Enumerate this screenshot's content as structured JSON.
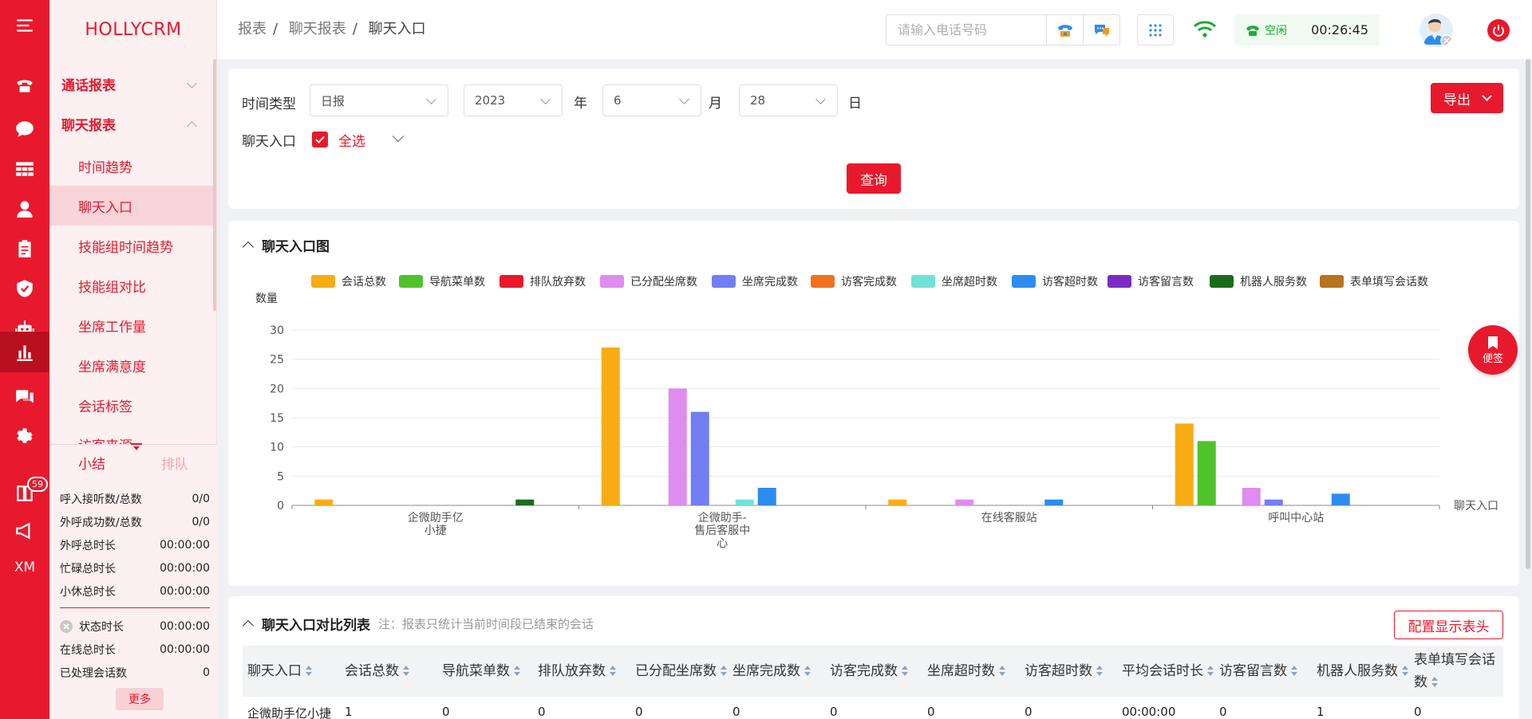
{
  "brand": "HOLLYCRM",
  "rail": {
    "badge_count": "59",
    "bottom_text": "XM"
  },
  "menu": {
    "group_call": "通话报表",
    "group_chat": "聊天报表",
    "items": [
      "时间趋势",
      "聊天入口",
      "技能组时间趋势",
      "技能组对比",
      "坐席工作量",
      "坐席满意度",
      "会话标签",
      "访客来源"
    ]
  },
  "summary": {
    "tab_summary": "小结",
    "tab_queue": "排队",
    "rows": [
      {
        "label": "呼入接听数/总数",
        "value": "0/0"
      },
      {
        "label": "外呼成功数/总数",
        "value": "0/0"
      },
      {
        "label": "外呼总时长",
        "value": "00:00:00"
      },
      {
        "label": "忙碌总时长",
        "value": "00:00:00"
      },
      {
        "label": "小休总时长",
        "value": "00:00:00"
      },
      {
        "label": "状态时长",
        "value": "00:00:00"
      },
      {
        "label": "在线总时长",
        "value": "00:00:00"
      },
      {
        "label": "已处理会话数",
        "value": "0"
      }
    ],
    "more": "更多"
  },
  "topbar": {
    "breadcrumb": [
      "报表",
      "聊天报表",
      "聊天入口"
    ],
    "phone_placeholder": "请输入电话号码",
    "status": "空闲",
    "timer": "00:26:45"
  },
  "filter": {
    "time_type_label": "时间类型",
    "time_type_value": "日报",
    "year_value": "2023",
    "year_unit": "年",
    "month_value": "6",
    "month_unit": "月",
    "day_value": "28",
    "day_unit": "日",
    "entry_label": "聊天入口",
    "select_all": "全选",
    "query": "查询",
    "export": "导出"
  },
  "chart_section": {
    "title": "聊天入口图"
  },
  "chart_data": {
    "type": "bar",
    "title": "",
    "ylabel": "数量",
    "xlabel": "聊天入口",
    "ylim": [
      0,
      30
    ],
    "yticks": [
      0,
      5,
      10,
      15,
      20,
      25,
      30
    ],
    "grid": true,
    "legend_position": "top",
    "categories": [
      "企微助手亿\n小捷",
      "企微助手-\n售后客服中\n心",
      "在线客服站",
      "呼叫中心站"
    ],
    "series": [
      {
        "name": "会话总数",
        "color": "#f8ac14",
        "values": [
          1,
          27,
          1,
          14
        ]
      },
      {
        "name": "导航菜单数",
        "color": "#4fc42a",
        "values": [
          0,
          0,
          0,
          11
        ]
      },
      {
        "name": "排队放弃数",
        "color": "#e8192c",
        "values": [
          0,
          0,
          0,
          0
        ]
      },
      {
        "name": "已分配坐席数",
        "color": "#e08bf0",
        "values": [
          0,
          20,
          1,
          3
        ]
      },
      {
        "name": "坐席完成数",
        "color": "#727ef4",
        "values": [
          0,
          16,
          0,
          1
        ]
      },
      {
        "name": "访客完成数",
        "color": "#f2711c",
        "values": [
          0,
          0,
          0,
          0
        ]
      },
      {
        "name": "坐席超时数",
        "color": "#6fe3d8",
        "values": [
          0,
          1,
          0,
          0
        ]
      },
      {
        "name": "访客超时数",
        "color": "#2d8cf0",
        "values": [
          0,
          3,
          1,
          2
        ]
      },
      {
        "name": "访客留言数",
        "color": "#7b2bc4",
        "values": [
          0,
          0,
          0,
          0
        ]
      },
      {
        "name": "机器人服务数",
        "color": "#1b6b1b",
        "values": [
          1,
          0,
          0,
          0
        ]
      },
      {
        "name": "表单填写会话数",
        "color": "#b8741a",
        "values": [
          0,
          0,
          0,
          0
        ]
      }
    ]
  },
  "table_section": {
    "title": "聊天入口对比列表",
    "note": "注：报表只统计当前时间段已结束的会话",
    "config_button": "配置显示表头",
    "headers": [
      "聊天入口",
      "会话总数",
      "导航菜单数",
      "排队放弃数",
      "已分配坐席数",
      "坐席完成数",
      "访客完成数",
      "坐席超时数",
      "访客超时数",
      "平均会话时长",
      "访客留言数",
      "机器人服务数",
      "表单填写会话数"
    ],
    "rows": [
      [
        "企微助手亿小捷",
        "1",
        "0",
        "0",
        "0",
        "0",
        "0",
        "0",
        "0",
        "00:00:00",
        "0",
        "1",
        "0"
      ]
    ]
  },
  "float": {
    "note_label": "便签"
  },
  "colors": {
    "accent": "#e8192c",
    "status_green": "#1aac33"
  }
}
